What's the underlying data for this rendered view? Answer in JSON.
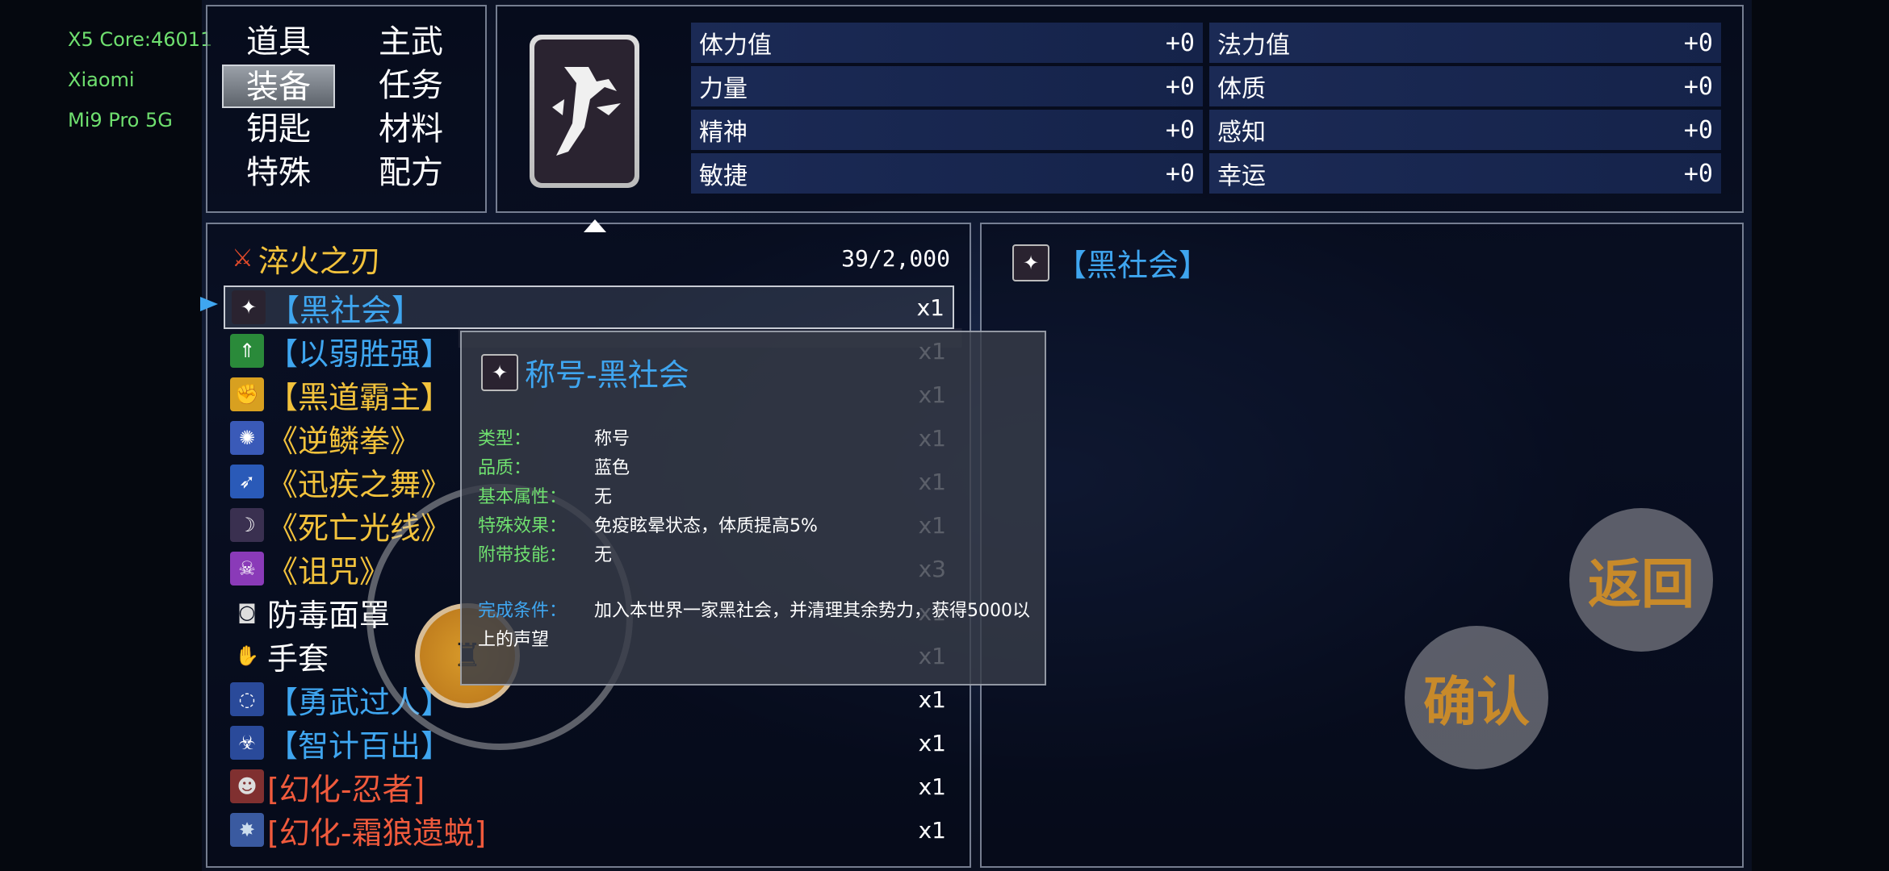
{
  "device": {
    "line1": "X5 Core:46011",
    "line2": "Xiaomi",
    "line3": "Mi9 Pro 5G"
  },
  "categories": [
    {
      "label": "道具"
    },
    {
      "label": "主武"
    },
    {
      "label": "装备",
      "active": true
    },
    {
      "label": "任务"
    },
    {
      "label": "钥匙"
    },
    {
      "label": "材料"
    },
    {
      "label": "特殊"
    },
    {
      "label": "配方"
    }
  ],
  "stats": [
    {
      "name": "体力值",
      "value": "+0"
    },
    {
      "name": "法力值",
      "value": "+0"
    },
    {
      "name": "力量",
      "value": "+0"
    },
    {
      "name": "体质",
      "value": "+0"
    },
    {
      "name": "精神",
      "value": "+0"
    },
    {
      "name": "感知",
      "value": "+0"
    },
    {
      "name": "敏捷",
      "value": "+0"
    },
    {
      "name": "幸运",
      "value": "+0"
    }
  ],
  "weapon": {
    "name": "淬火之刃",
    "capacity": "39/2,000"
  },
  "items": [
    {
      "name": "【黑社会】",
      "qty": "x1",
      "color": "blue",
      "icon": "title-icon",
      "selected": true
    },
    {
      "name": "【以弱胜强】",
      "qty": "x1",
      "color": "blue",
      "icon": "arrow-up-icon"
    },
    {
      "name": "【黑道霸主】",
      "qty": "x1",
      "color": "gold",
      "icon": "fist-icon"
    },
    {
      "name": "《逆鳞拳》",
      "qty": "x1",
      "color": "gold",
      "icon": "burst-icon"
    },
    {
      "name": "《迅疾之舞》",
      "qty": "x1",
      "color": "gold",
      "icon": "dash-icon"
    },
    {
      "name": "《死亡光线》",
      "qty": "x1",
      "color": "gold",
      "icon": "crescent-icon"
    },
    {
      "name": "《诅咒》",
      "qty": "x3",
      "color": "gold",
      "icon": "skull-icon"
    },
    {
      "name": "防毒面罩",
      "qty": "x1",
      "color": "white",
      "icon": "gas-mask-icon"
    },
    {
      "name": "手套",
      "qty": "x1",
      "color": "white",
      "icon": "glove-icon"
    },
    {
      "name": "【勇武过人】",
      "qty": "x1",
      "color": "blue",
      "icon": "swirl-icon"
    },
    {
      "name": "【智计百出】",
      "qty": "x1",
      "color": "blue",
      "icon": "biohazard-icon"
    },
    {
      "name": "[幻化-忍者]",
      "qty": "x1",
      "color": "red",
      "icon": "ninja-icon"
    },
    {
      "name": "[幻化-霜狼遗蜕]",
      "qty": "x1",
      "color": "red",
      "icon": "wolf-icon"
    }
  ],
  "detail": {
    "title": "【黑社会】"
  },
  "tooltip": {
    "title": "称号-黑社会",
    "rows": [
      {
        "label": "类型：",
        "value": "称号"
      },
      {
        "label": "品质：",
        "value": "蓝色"
      },
      {
        "label": "基本属性：",
        "value": "无"
      },
      {
        "label": "特殊效果：",
        "value": "免疫眩晕状态，体质提高5%"
      },
      {
        "label": "附带技能：",
        "value": "无"
      }
    ],
    "condition_label": "完成条件：",
    "condition_value": "加入本世界一家黑社会，并清理其余势力，获得5000以上的声望"
  },
  "buttons": {
    "back": "返回",
    "confirm": "确认"
  },
  "colors": {
    "blue": "#3fa6f0",
    "gold": "#f2c23c",
    "white": "#ffffff",
    "red": "#f05a3c",
    "green": "#6fe06f"
  }
}
